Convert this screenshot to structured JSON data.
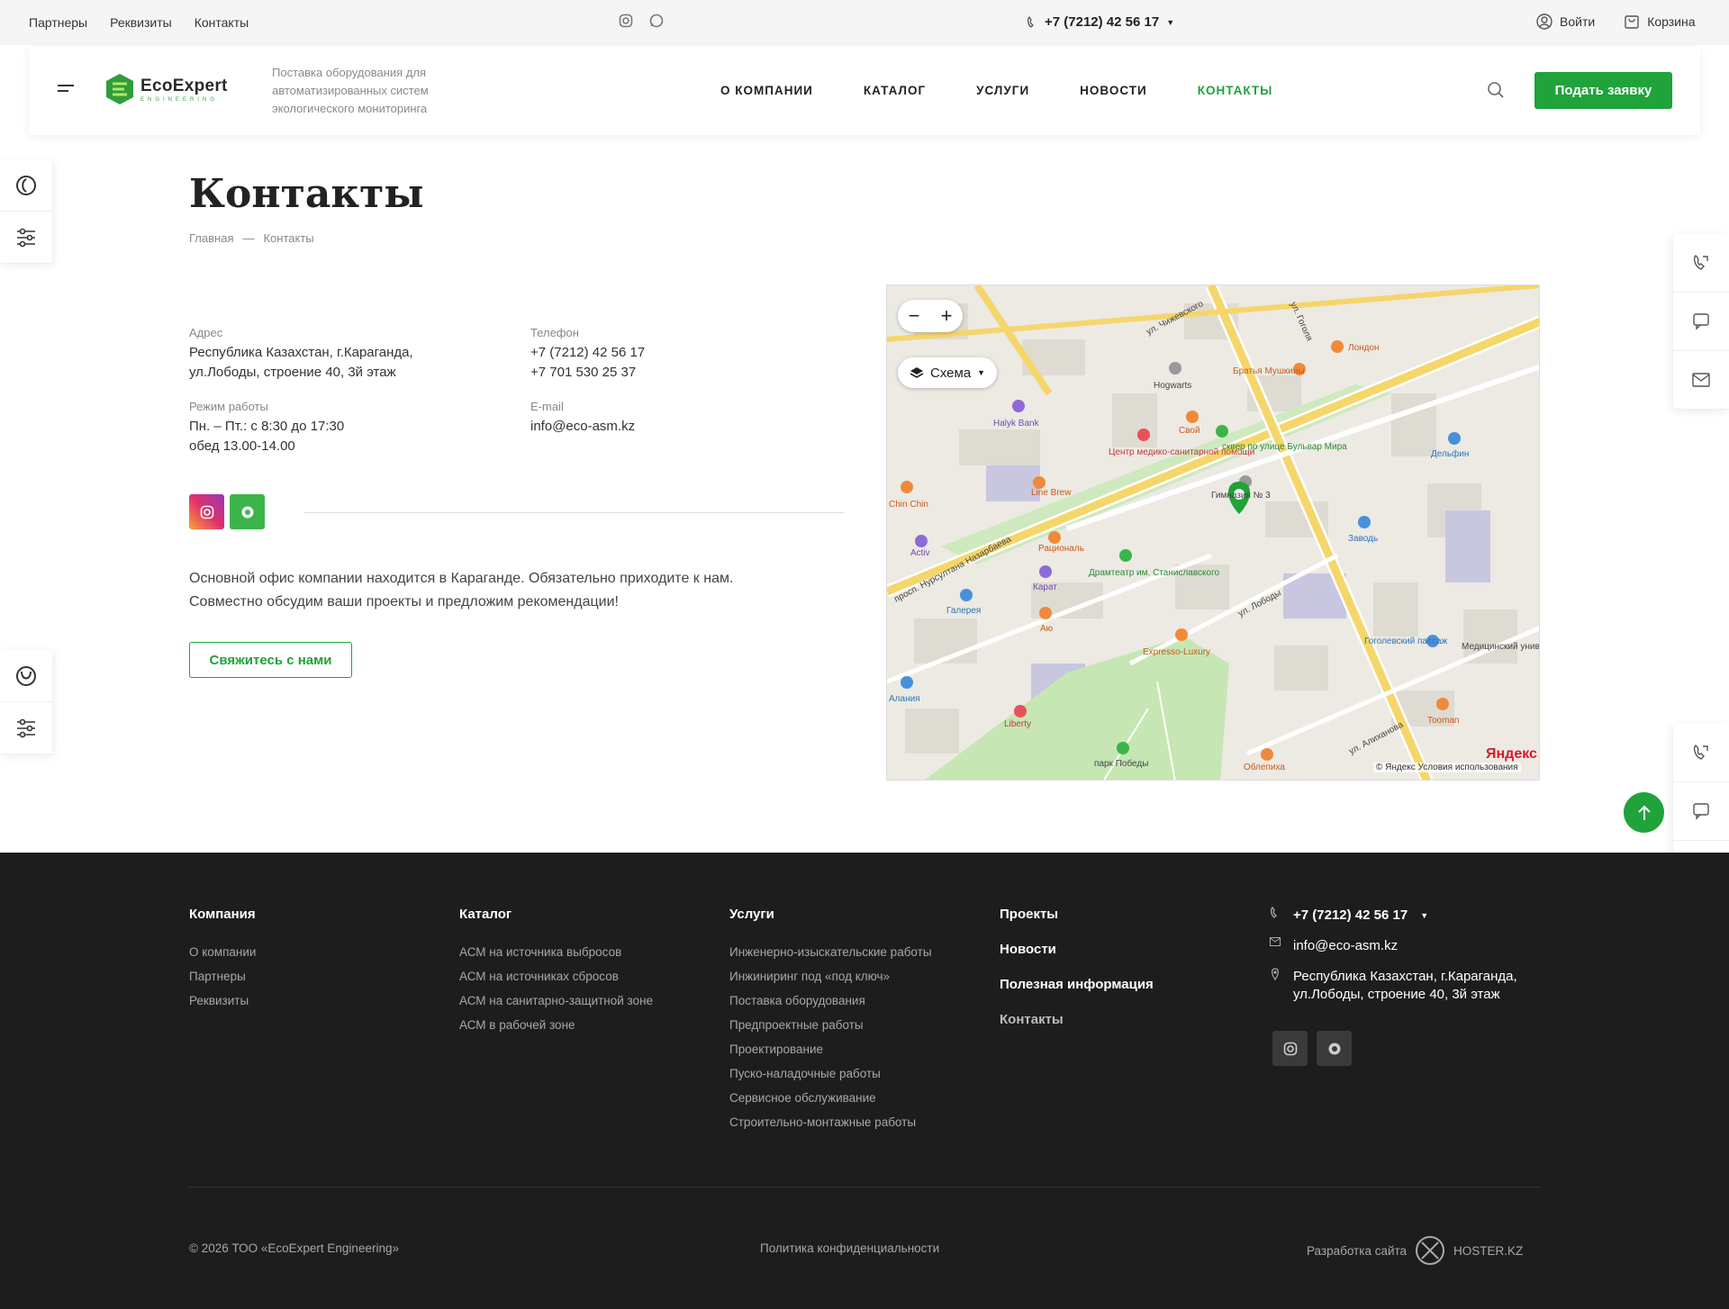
{
  "topbar": {
    "links": [
      "Партнеры",
      "Реквизиты",
      "Контакты"
    ],
    "phone": "+7 (7212) 42 56 17",
    "login": "Войти",
    "cart": "Корзина"
  },
  "header": {
    "logo_text": "EcoExpert",
    "logo_sub": "ENGINEERING",
    "tagline": "Поставка оборудования для автоматизированных систем экологического мониторинга",
    "nav": [
      "О КОМПАНИИ",
      "КАТАЛОГ",
      "УСЛУГИ",
      "НОВОСТИ",
      "КОНТАКТЫ"
    ],
    "cta": "Подать заявку"
  },
  "page": {
    "title": "Контакты",
    "breadcrumb": [
      "Главная",
      "—",
      "Контакты"
    ]
  },
  "contacts": {
    "address_label": "Адрес",
    "address": "Республика Казахстан, г.Караганда, ул.Лободы, строение 40, 3й этаж",
    "phone_label": "Телефон",
    "phone1": "+7 (7212) 42 56 17",
    "phone2": "+7 701 530 25 37",
    "hours_label": "Режим работы",
    "hours1": "Пн. – Пт.: с 8:30 до 17:30",
    "hours2": "обед 13.00-14.00",
    "email_label": "E-mail",
    "email": "info@eco-asm.kz",
    "description": "Основной офис компании находится в Караганде. Обязательно приходите к нам. Совместно обсудим ваши проекты и предложим рекомендации!",
    "contact_button": "Свяжитесь с нами"
  },
  "map": {
    "layer_button": "Схема",
    "brand": "Яндекс",
    "copyright": "© Яндекс  Условия использования",
    "labels": [
      "ул. Чижевского",
      "ул. Гоголя",
      "Братья Мушкины",
      "Лондон",
      "Hogwarts",
      "Halyk Bank",
      "Свой",
      "сквер по улице Бульвар Мира",
      "Центр медико-санитарной помощи",
      "Дельфин",
      "Line Brew",
      "Chin Chin",
      "Гимназия № 3",
      "Заводь",
      "Activ",
      "Рациональ",
      "Драмтеатр им. Станиславского",
      "просп. Нурсултана Назарбаева",
      "Карат",
      "Галерея",
      "Аю",
      "Expresso-Luxury",
      "ул. Лободы",
      "Гоголевский пассаж",
      "Медицинский университет",
      "Алания",
      "Liberty",
      "Tooman",
      "парк Победы",
      "Облепиха",
      "ул. Алиханова"
    ]
  },
  "footer": {
    "col1_title": "Компания",
    "col1": [
      "О компании",
      "Партнеры",
      "Реквизиты"
    ],
    "col2_title": "Каталог",
    "col2": [
      "АСМ на источника выбросов",
      "АСМ на источниках сбросов",
      "АСМ на санитарно-защитной зоне",
      "АСМ в рабочей зоне"
    ],
    "col3_title": "Услуги",
    "col3": [
      "Инженерно-изыскательские работы",
      "Инжиниринг под «под ключ»",
      "Поставка оборудования",
      "Предпроектные работы",
      "Проектирование",
      "Пуско-наладочные работы",
      "Сервисное обслуживание",
      "Строительно-монтажные работы"
    ],
    "col4": [
      "Проекты",
      "Новости",
      "Полезная информация",
      "Контакты"
    ],
    "phone": "+7 (7212) 42 56 17",
    "email": "info@eco-asm.kz",
    "address": "Республика Казахстан, г.Караганда, ул.Лободы, строение 40, 3й этаж",
    "copyright": "© 2026 ТОО «EcoExpert Engineering»",
    "privacy": "Политика конфиденциальности",
    "dev_label": "Разработка сайта",
    "dev_brand": "HOSTER.KZ"
  },
  "colors": {
    "accent": "#1fa33a",
    "footer_bg": "#1d1d1d",
    "instagram": "#e1306c",
    "whatsapp": "#3bb54a"
  }
}
